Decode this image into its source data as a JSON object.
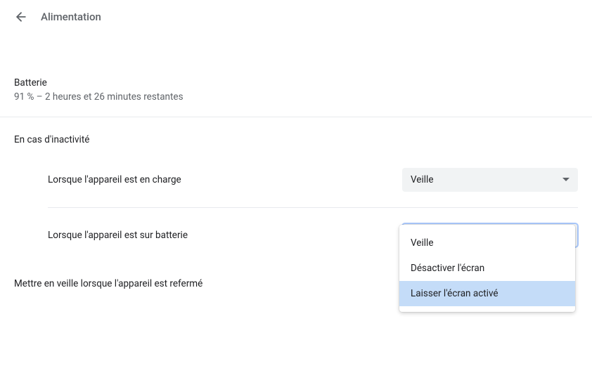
{
  "header": {
    "title": "Alimentation"
  },
  "battery": {
    "title": "Batterie",
    "status": "91 % – 2 heures et 26 minutes restantes"
  },
  "inactivity": {
    "section_title": "En cas d'inactivité",
    "charging": {
      "label": "Lorsque l'appareil est en charge",
      "value": "Veille"
    },
    "battery": {
      "label": "Lorsque l'appareil est sur batterie",
      "value": "Veille"
    }
  },
  "lid": {
    "label": "Mettre en veille lorsque l'appareil est refermé"
  },
  "dropdown": {
    "options": [
      {
        "label": "Veille",
        "highlighted": false
      },
      {
        "label": "Désactiver l'écran",
        "highlighted": false
      },
      {
        "label": "Laisser l'écran activé",
        "highlighted": true
      }
    ]
  }
}
